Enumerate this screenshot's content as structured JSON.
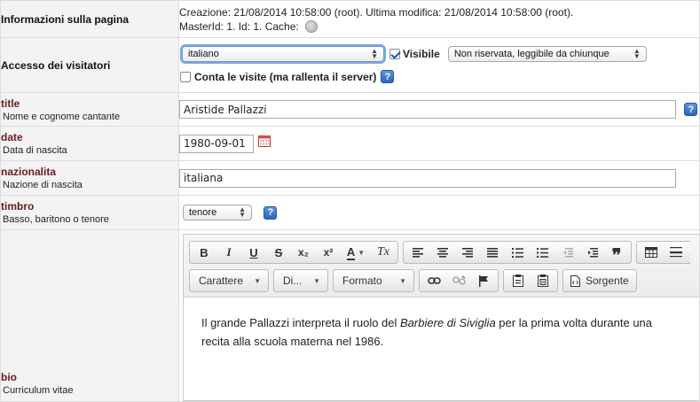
{
  "info": {
    "label": "Informazioni sulla pagina",
    "line1": "Creazione: 21/08/2014 10:58:00 (root). Ultima modifica: 21/08/2014 10:58:00 (root).",
    "line2": "MasterId: 1. Id: 1. Cache:"
  },
  "access": {
    "label": "Accesso dei visitatori",
    "language": "italiano",
    "visible_label": "Visibile",
    "visible_checked": true,
    "visibility": "Non riservata, leggibile da chiunque",
    "count_label": "Conta le visite (ma rallenta il server)",
    "count_checked": false
  },
  "fields": {
    "title": {
      "name": "title",
      "desc": "Nome e cognome cantante",
      "value": "Aristide Pallazzi"
    },
    "date": {
      "name": "date",
      "desc": "Data di nascita",
      "value": "1980-09-01"
    },
    "nazionalita": {
      "name": "nazionalita",
      "desc": "Nazione di nascita",
      "value": "italiana"
    },
    "timbro": {
      "name": "timbro",
      "desc": "Basso, baritono o tenore",
      "value": "tenore"
    },
    "bio": {
      "name": "bio",
      "desc": "Curriculum vitae"
    }
  },
  "help_glyph": "?",
  "editor": {
    "toolbar": {
      "bold": "B",
      "italic": "I",
      "underline": "U",
      "strike": "S",
      "subscript": "x₂",
      "superscript": "x²",
      "text_color": "A",
      "remove_format": "Tx",
      "blockquote": "❞",
      "styles_label": "Carattere",
      "font_label": "Di...",
      "format_label": "Formato",
      "source_label": "Sorgente"
    },
    "content": {
      "before": "Il grande Pallazzi interpreta il ruolo del ",
      "em": "Barbiere di Siviglia",
      "after": " per la prima volta durante una recita alla scuola materna nel 1986."
    }
  }
}
